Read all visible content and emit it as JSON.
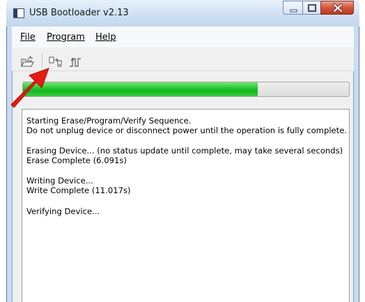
{
  "window": {
    "title": "USB Bootloader v2.13"
  },
  "menu": {
    "file": "File",
    "program": "Program",
    "help": "Help"
  },
  "toolbar": {
    "icons": [
      "open-folder-icon",
      "erase-program-verify-icon",
      "reset-device-icon"
    ]
  },
  "progress": {
    "value": 0.72
  },
  "log": {
    "lines": [
      "Starting Erase/Program/Verify Sequence.",
      "Do not unplug device or disconnect power until the operation is fully complete.",
      "Erasing Device... (no status update until complete, may take several seconds)",
      "Erase Complete (6.091s)",
      "Writing Device...",
      "Write Complete (11.017s)",
      "Verifying Device..."
    ]
  },
  "colors": {
    "progress_fill": "#17b423",
    "annotation_arrow": "#e31b12",
    "close_button": "#c2361e"
  }
}
